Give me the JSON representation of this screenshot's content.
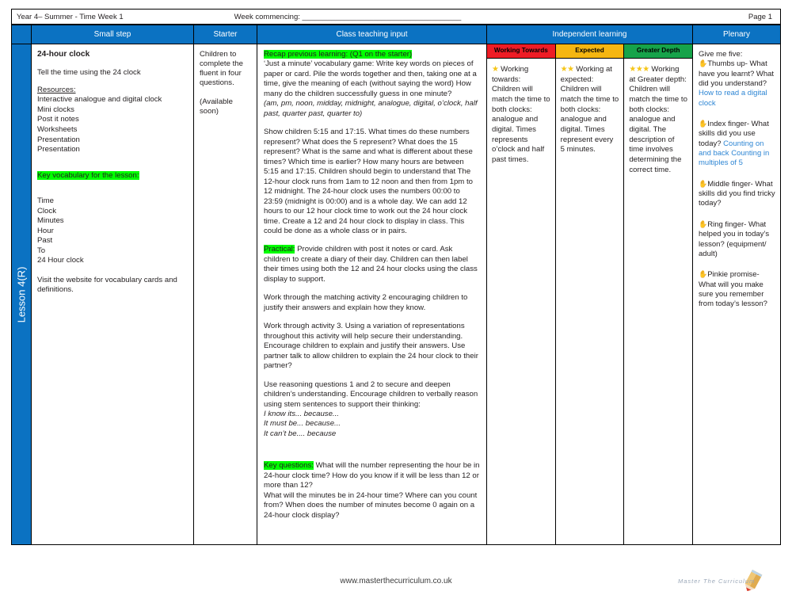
{
  "meta": {
    "year_term": "Year 4– Summer - Time Week 1",
    "week_commencing": "Week commencing: ______________________________________",
    "page": "Page 1"
  },
  "spine": {
    "lesson_label": "Lesson 4(R)"
  },
  "headers": {
    "small_step": "Small step",
    "starter": "Starter",
    "class_teaching_input": "Class teaching input",
    "independent_learning": "Independent learning",
    "plenary": "Plenary"
  },
  "colors": {
    "header_blue": "#0b72c2",
    "highlight_green": "#00ff00",
    "working_towards_red": "#ee1c25",
    "expected_amber": "#f5b611",
    "greater_depth_green": "#16a34a",
    "hyperlink_blue": "#2e86d4",
    "star_gold": "#f5c518",
    "hand_brown": "#b5763a"
  },
  "small_step": {
    "title": "24-hour clock",
    "objective": "Tell the time using the 24 clock",
    "resources_label": "Resources:",
    "resources": [
      "Interactive  analogue and digital clock",
      "Mini clocks",
      "Post it notes",
      "Worksheets",
      "Presentation",
      "Presentation"
    ],
    "vocab_heading": "Key vocabulary for the lesson:",
    "vocab": [
      "Time",
      "Clock",
      "Minutes",
      "Hour",
      "Past",
      "To",
      "24 Hour clock"
    ],
    "vocab_note": "Visit the website for vocabulary cards and definitions."
  },
  "starter": {
    "line1": "Children to complete the fluent in four questions.",
    "line2": "(Available soon)"
  },
  "teaching": {
    "recap_label": "Recap previous learning: (Q1 on the starter)",
    "recap_body": "‘Just a minute’ vocabulary game:  Write key words on pieces of paper or card. Pile the words together and then, taking one at a time, give the meaning of each (without saying the word) How many do the children successfully guess in one minute?",
    "recap_words": "(am, pm, noon, midday, midnight, analogue, digital, o’clock, half past, quarter past, quarter to)",
    "para_main": "Show children 5:15 and 17:15.  What times do these numbers represent?  What does the 5 represent?  What does the 15 represent? What is the same and what is different about these times?  Which time is earlier?  How many hours are between 5:15 and 17:15.  Children should begin to understand that The 12-hour clock runs from 1am to 12 noon and then from 1pm to 12 midnight. The 24-hour clock uses the numbers 00:00 to 23:59 (midnight is 00:00) and is a whole day.  We can add 12 hours  to our 12 hour clock time to work out the  24 hour clock time.  Create a 12 and 24 hour clock to display in class. This could be done as a whole class or in pairs.",
    "practical_label": "Practical:",
    "practical_body": " Provide children with post it notes or card.  Ask children to create a diary of their day.  Children  can then label their times using both the 12 and 24  hour clocks using the class display to support.",
    "para_activity2": "Work through the matching activity 2 encouraging children to justify their answers and explain how they know.",
    "para_activity3": "Work through activity 3.  Using a variation of representations throughout this activity will help secure their understanding. Encourage children to explain and justify their answers. Use partner talk to allow children to  explain the 24 hour clock to their partner?",
    "para_reasoning": "Use reasoning questions 1 and 2 to secure and deepen children’s understanding.  Encourage children to verbally reason using stem sentences to support their thinking:",
    "stems": [
      "I know its... because...",
      "It must be... because...",
      "It can’t be.... because"
    ],
    "key_questions_label": "Key questions:",
    "key_questions_body": " What will the number representing the hour be in 24-hour clock time? How do you know if it will be less than 12 or more than 12?",
    "key_questions_body2": "What will the minutes be in 24-hour time? Where can you count from? When does the number of minutes become 0 again on a 24-hour clock display?"
  },
  "independent": [
    {
      "band_label": "Working Towards",
      "band_color": "#ee1c25",
      "stars": 1,
      "heading": "Working towards:",
      "body": "Children will match the time to both clocks: analogue and digital. Times represents o’clock and half past times."
    },
    {
      "band_label": "Expected",
      "band_color": "#f5b611",
      "stars": 2,
      "heading": "Working at expected:",
      "body": " Children will match the time to both clocks: analogue and digital. Times represent every 5 minutes."
    },
    {
      "band_label": "Greater Depth",
      "band_color": "#16a34a",
      "stars": 3,
      "heading": "Working at Greater depth:",
      "body": "Children will match the time to both clocks: analogue and digital. The description of time involves determining the correct time."
    }
  ],
  "plenary": {
    "intro": "Give me five:",
    "items": [
      {
        "icon": "hand-icon",
        "label": "Thumbs up-",
        "question": "What have you learnt? What did you understand?",
        "links": [
          "How to read a digital clock"
        ]
      },
      {
        "icon": "hand-icon",
        "label": "Index finger-",
        "question": "What skills did you use today?",
        "links": [
          "Counting on and back",
          "Counting in multiples of 5"
        ]
      },
      {
        "icon": "hand-icon",
        "label": "Middle finger-",
        "question": "What skills did you find tricky today?",
        "links": []
      },
      {
        "icon": "hand-icon",
        "label": "Ring finger-",
        "question": "What helped you in today’s lesson? (equipment/ adult)",
        "links": []
      },
      {
        "icon": "hand-icon",
        "label": "Pinkie promise-",
        "question": " What will you make sure you remember from today’s lesson?",
        "links": []
      }
    ]
  },
  "footer": {
    "url": "www.masterthecurriculum.co.uk",
    "logo_text": "Master  The  Curriculum"
  }
}
